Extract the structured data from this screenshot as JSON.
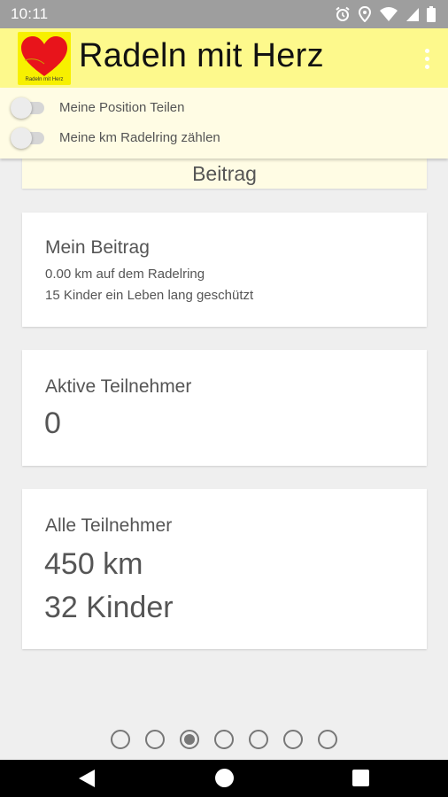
{
  "status_bar": {
    "time": "10:11",
    "icons": [
      "alarm-icon",
      "location-icon",
      "wifi-icon",
      "signal-icon",
      "battery-icon"
    ]
  },
  "app_bar": {
    "title": "Radeln mit Herz",
    "logo_caption": "Radeln mit Herz",
    "background": "#fdf98c"
  },
  "settings": {
    "share_position_label": "Meine Position Teilen",
    "count_km_label": "Meine km Radelring zählen",
    "share_position_on": false,
    "count_km_on": false
  },
  "section": {
    "title": "Beitrag"
  },
  "my_contribution": {
    "title": "Mein Beitrag",
    "km_line": "0.00 km auf dem Radelring",
    "children_line": "15 Kinder ein Leben lang geschützt"
  },
  "active_participants": {
    "title": "Aktive Teilnehmer",
    "value": "0"
  },
  "all_participants": {
    "title": "Alle Teilnehmer",
    "km": "450 km",
    "children": "32 Kinder"
  },
  "pager": {
    "total": 7,
    "active_index": 2
  },
  "colors": {
    "accent_yellow": "#fdf98c",
    "panel_yellow": "#fffce4",
    "heart_red": "#e8141b"
  }
}
